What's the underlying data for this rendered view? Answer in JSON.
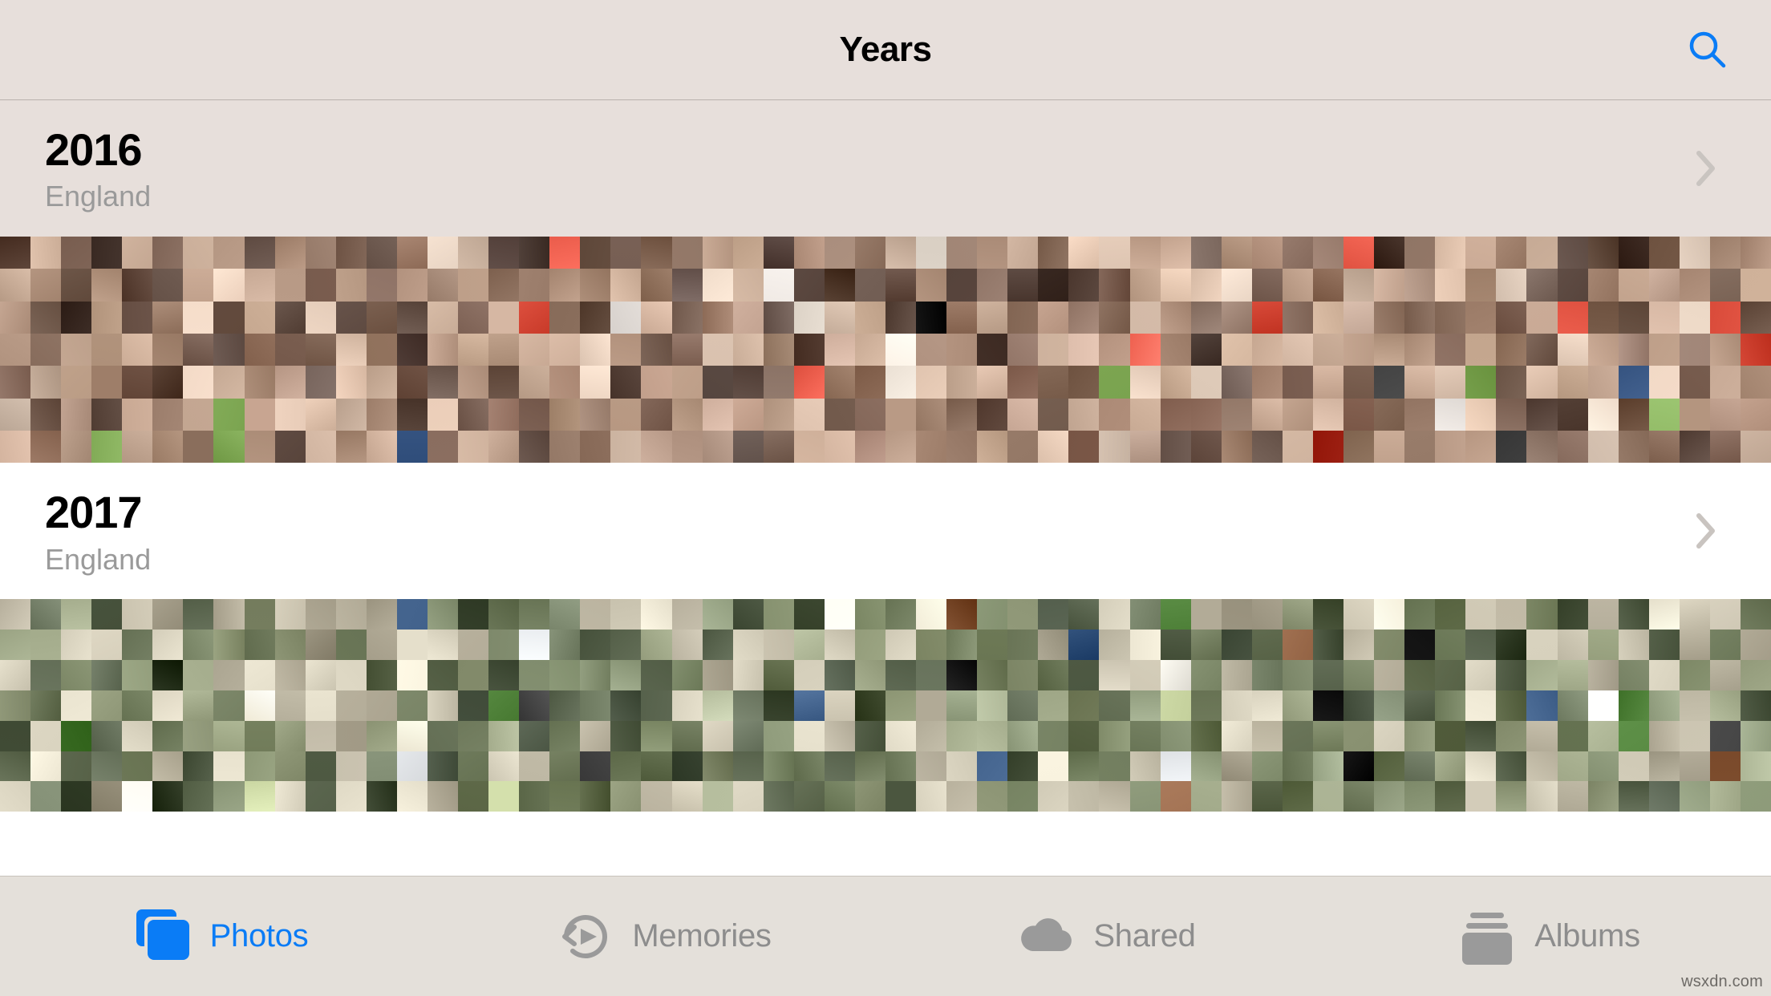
{
  "navbar": {
    "title": "Years",
    "search_icon": "search-icon",
    "search_color": "#0a7cf6"
  },
  "sections": [
    {
      "year": "2016",
      "location": "England",
      "background": "#e7dfdb",
      "disclosure_icon": "chevron-right-icon",
      "photo_count_approx": 406
    },
    {
      "year": "2017",
      "location": "England",
      "background": "#ffffff",
      "disclosure_icon": "chevron-right-icon",
      "photo_count_approx": 406
    }
  ],
  "tabbar": {
    "background": "#e4e0da",
    "active_color": "#0a7cf6",
    "inactive_color": "#8d8d8d",
    "tabs": [
      {
        "label": "Photos",
        "icon": "photos-icon",
        "active": true
      },
      {
        "label": "Memories",
        "icon": "memories-icon",
        "active": false
      },
      {
        "label": "Shared",
        "icon": "cloud-icon",
        "active": false
      },
      {
        "label": "Albums",
        "icon": "albums-icon",
        "active": false
      }
    ]
  },
  "watermark": {
    "text": "wsxdn.com"
  },
  "mosaics": {
    "y2016": {
      "columns": 58,
      "rows": 7,
      "palette": [
        "#7b5f52",
        "#c8a896",
        "#8e6b5b",
        "#e0c7b4",
        "#5d4a42",
        "#b08d79",
        "#9c7a66",
        "#d8bba6",
        "#6d5448",
        "#a98d7c",
        "#c2a28d",
        "#7f6254",
        "#4f3f38",
        "#e6d2c0",
        "#8a6f5f",
        "#bfa08c",
        "#6a5247",
        "#d5b9a5",
        "#96796a",
        "#b59580",
        "#7a5d4f",
        "#cfb199",
        "#5a463d",
        "#e2cab7",
        "#8d7264",
        "#ab8b77",
        "#735849",
        "#c6a894",
        "#624e44",
        "#dcc0ab",
        "#9a7c6a",
        "#b99a85",
        "#6e5648",
        "#d2b49e",
        "#55423a",
        "#e8d4c3",
        "#826654",
        "#c0a18b",
        "#67514440",
        "#a0846f",
        "#7d6153",
        "#cbad96",
        "#594640",
        "#e4ccb9",
        "#907361",
        "#ad8e79",
        "#70594b",
        "#c9ab93",
        "#604c42",
        "#dec2ad",
        "#9d7f6d",
        "#bc9d88",
        "#71594c",
        "#d4b6a0",
        "#57443c",
        "#ead6c5",
        "#856957",
        "#c3a48e"
      ],
      "accents": [
        "#2b2b2b",
        "#d94b3a",
        "#e8e2dd",
        "#3f5d8a",
        "#7aa34f",
        "#000000",
        "#f0e6da",
        "#b83b2e"
      ]
    },
    "y2017": {
      "columns": 58,
      "rows": 7,
      "palette": [
        "#6f7a5c",
        "#b9b29e",
        "#7e8a6a",
        "#d3cdb9",
        "#4f5a44",
        "#9aa383",
        "#8b9472",
        "#c7c1ad",
        "#5f6a50",
        "#a5ad8d",
        "#bdb6a2",
        "#73805f",
        "#46513c",
        "#dcd6c2",
        "#7b8768",
        "#b2ab97",
        "#5a6549",
        "#cdc7b3",
        "#8792718",
        "#a9b191",
        "#6b7658",
        "#c2bba7",
        "#4b5640",
        "#d8d2be",
        "#818d6e",
        "#9fa787",
        "#64704d",
        "#c4bda9",
        "#535e47",
        "#d6d0bc",
        "#8d9576",
        "#b0a994",
        "#6e7a5b",
        "#cbc5b1",
        "#4d5842",
        "#e0dac6",
        "#778363",
        "#bab3a0",
        "#5c6748",
        "#9ba383",
        "#78846a",
        "#c5beab",
        "#4a5543",
        "#ded8c4",
        "#8a9573",
        "#a7af8f",
        "#6a7554",
        "#c8c1ad",
        "#57624b",
        "#d4ceba",
        "#939b7c",
        "#b5ae9a",
        "#6c7759",
        "#cfc9b5",
        "#505b44",
        "#e2dcc8",
        "#7e8a6b",
        "#bcb5a1"
      ],
      "accents": [
        "#2f2f2f",
        "#4a7c34",
        "#e6e9ec",
        "#35557f",
        "#c8d4a0",
        "#000000",
        "#f2efe6",
        "#8a5a3b"
      ]
    }
  }
}
